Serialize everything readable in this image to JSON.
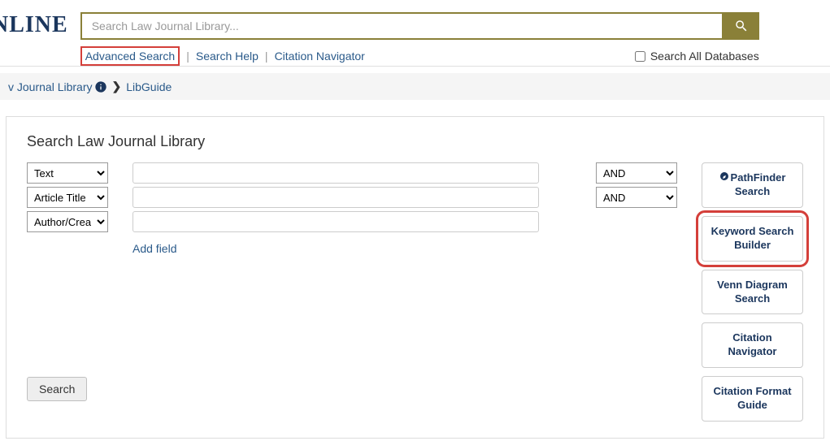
{
  "header": {
    "logo": "NLINE",
    "search_placeholder": "Search Law Journal Library...",
    "links": {
      "advanced": "Advanced Search",
      "help": "Search Help",
      "citation_nav": "Citation Navigator"
    },
    "search_all": "Search All Databases"
  },
  "breadcrumb": {
    "item1": "v Journal Library",
    "item2": "LibGuide"
  },
  "panel": {
    "title": "Search Law Journal Library",
    "fields": {
      "f1": "Text",
      "f2": "Article Title",
      "f3": "Author/Creator"
    },
    "ops": {
      "op1": "AND",
      "op2": "AND"
    },
    "add_field": "Add field",
    "submit": "Search"
  },
  "side": {
    "pathfinder": "PathFinder Search",
    "keyword": "Keyword Search Builder",
    "venn": "Venn Diagram Search",
    "citation_nav": "Citation Navigator",
    "citation_format": "Citation Format Guide"
  }
}
